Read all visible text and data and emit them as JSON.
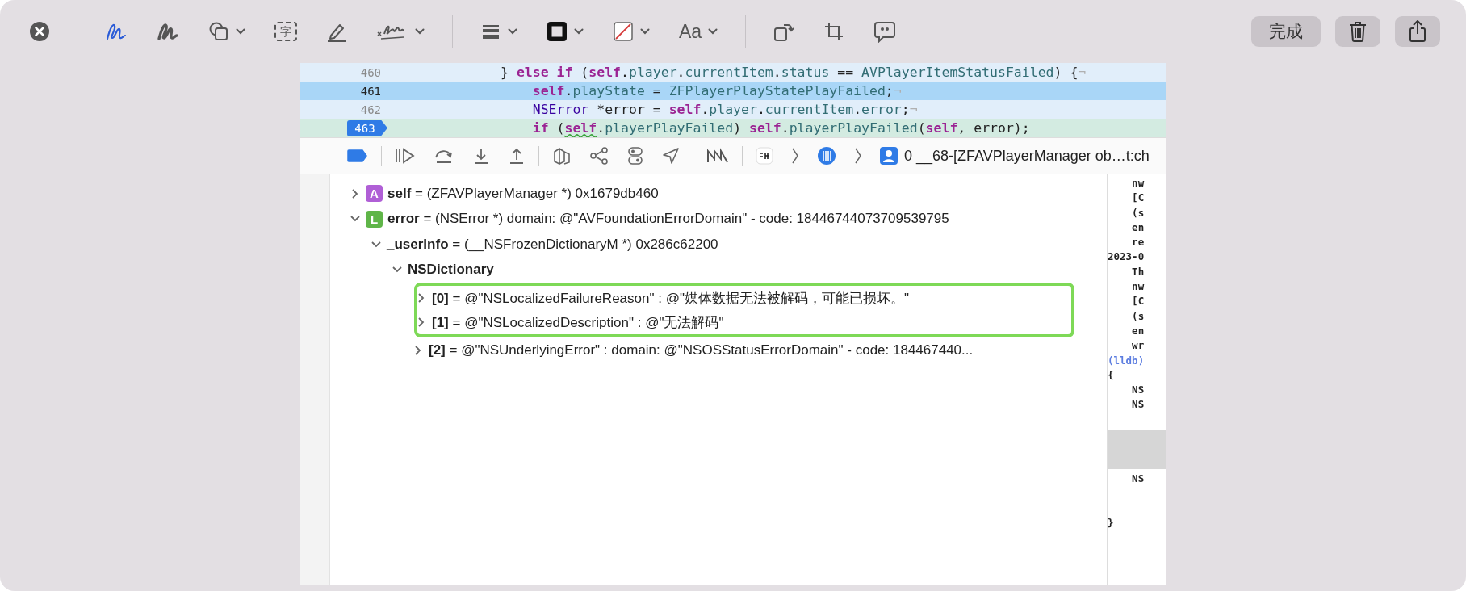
{
  "toolbar": {
    "tools": [
      {
        "kind": "sketch",
        "selected": true,
        "menu": false
      },
      {
        "kind": "draw",
        "selected": false,
        "menu": false
      },
      {
        "kind": "shapes",
        "selected": false,
        "menu": true
      },
      {
        "kind": "textbox",
        "selected": false,
        "menu": false,
        "label": "字"
      },
      {
        "kind": "highlight",
        "selected": false,
        "menu": false
      },
      {
        "kind": "sign",
        "selected": false,
        "menu": true
      },
      {
        "kind": "divider"
      },
      {
        "kind": "line-style",
        "selected": false,
        "menu": true
      },
      {
        "kind": "border-color",
        "selected": false,
        "menu": true
      },
      {
        "kind": "fill-color",
        "selected": false,
        "menu": true
      },
      {
        "kind": "font",
        "selected": false,
        "menu": true,
        "label": "Aa"
      },
      {
        "kind": "divider"
      },
      {
        "kind": "rotate",
        "selected": false,
        "menu": false
      },
      {
        "kind": "crop",
        "selected": false,
        "menu": false
      },
      {
        "kind": "description",
        "selected": false,
        "menu": false
      }
    ],
    "buttons": [
      {
        "kind": "text",
        "label": "完成"
      },
      {
        "kind": "trash"
      },
      {
        "kind": "share"
      }
    ]
  },
  "code": {
    "lines": [
      {
        "number": "460",
        "selected": false,
        "current": false,
        "breakpoint": false,
        "tokens": [
          {
            "kind": "plain",
            "text": "} "
          },
          {
            "kind": "keyword",
            "text": "else if"
          },
          {
            "kind": "plain",
            "text": " ("
          },
          {
            "kind": "keyword",
            "text": "self"
          },
          {
            "kind": "plain",
            "text": "."
          },
          {
            "kind": "property",
            "text": "player"
          },
          {
            "kind": "plain",
            "text": "."
          },
          {
            "kind": "property",
            "text": "currentItem"
          },
          {
            "kind": "plain",
            "text": "."
          },
          {
            "kind": "property",
            "text": "status"
          },
          {
            "kind": "plain",
            "text": " == "
          },
          {
            "kind": "enum",
            "text": "AVPlayerItemStatusFailed"
          },
          {
            "kind": "plain",
            "text": ") {"
          },
          {
            "kind": "invisible",
            "text": "¬"
          }
        ],
        "children": [
          {
            "number": "461",
            "selected": true,
            "current": false,
            "breakpoint": false,
            "tokens": [
              {
                "kind": "keyword",
                "text": "self"
              },
              {
                "kind": "plain",
                "text": "."
              },
              {
                "kind": "property",
                "text": "playState"
              },
              {
                "kind": "plain",
                "text": " = "
              },
              {
                "kind": "enum",
                "text": "ZFPlayerPlayStatePlayFailed"
              },
              {
                "kind": "plain",
                "text": ";"
              },
              {
                "kind": "invisible",
                "text": "¬"
              }
            ]
          },
          {
            "number": "462",
            "selected": false,
            "current": false,
            "breakpoint": false,
            "tokens": [
              {
                "kind": "type",
                "text": "NSError"
              },
              {
                "kind": "plain",
                "text": " *error = "
              },
              {
                "kind": "keyword",
                "text": "self"
              },
              {
                "kind": "plain",
                "text": "."
              },
              {
                "kind": "property",
                "text": "player"
              },
              {
                "kind": "plain",
                "text": "."
              },
              {
                "kind": "property",
                "text": "currentItem"
              },
              {
                "kind": "plain",
                "text": "."
              },
              {
                "kind": "property",
                "text": "error"
              },
              {
                "kind": "plain",
                "text": ";"
              },
              {
                "kind": "invisible",
                "text": "¬"
              }
            ]
          },
          {
            "number": "463",
            "selected": false,
            "current": true,
            "breakpoint": true,
            "tokens": [
              {
                "kind": "keyword",
                "text": "if"
              },
              {
                "kind": "plain",
                "text": " ("
              },
              {
                "kind": "keyword-flagged",
                "text": "self"
              },
              {
                "kind": "plain",
                "text": "."
              },
              {
                "kind": "property",
                "text": "playerPlayFailed"
              },
              {
                "kind": "plain",
                "text": ") "
              },
              {
                "kind": "keyword",
                "text": "self"
              },
              {
                "kind": "plain",
                "text": "."
              },
              {
                "kind": "property",
                "text": "playerPlayFailed"
              },
              {
                "kind": "plain",
                "text": "("
              },
              {
                "kind": "keyword",
                "text": "self"
              },
              {
                "kind": "plain",
                "text": ", error);"
              }
            ]
          }
        ]
      }
    ]
  },
  "debug_bar": {
    "breakpoints_active": true,
    "frame": "0 __68-[ZFAVPlayerManager ob…t:ch"
  },
  "variables": [
    {
      "kind": "variable",
      "badge": "A",
      "color": "#b05fd6",
      "text": "**self** = (ZFAVPlayerManager *) 0x1679db460",
      "expanded": false,
      "boxed": false
    },
    {
      "kind": "variable",
      "badge": "L",
      "color": "#5fb548",
      "text": "**error** = (NSError *) domain: @\"AVFoundationErrorDomain\" - code: 18446744073709539795",
      "expanded": true,
      "boxed": false,
      "children": [
        {
          "kind": "variable",
          "text": "**_userInfo** = (__NSFrozenDictionaryM *) 0x286c62200",
          "expanded": true,
          "boxed": false,
          "children": [
            {
              "kind": "group",
              "text": "NSDictionary",
              "expanded": true,
              "boxed": false,
              "children": [
                {
                  "kind": "variable",
                  "text": "**[0]** = @\"NSLocalizedFailureReason\" : @\"媒体数据无法被解码，可能已损坏。\"",
                  "expanded": false,
                  "boxed": true
                },
                {
                  "kind": "variable",
                  "text": "**[1]** = @\"NSLocalizedDescription\" : @\"无法解码\"",
                  "expanded": false,
                  "boxed": true
                },
                {
                  "kind": "variable",
                  "text": "**[2]** = @\"NSUnderlyingError\" : domain: @\"NSOSStatusErrorDomain\" - code: 184467440...",
                  "expanded": false,
                  "boxed": false
                }
              ]
            }
          ]
        }
      ]
    }
  ],
  "console": [
    {
      "kind": "text",
      "text": "    nw"
    },
    {
      "kind": "text",
      "text": "    [C"
    },
    {
      "kind": "text",
      "text": "    (s"
    },
    {
      "kind": "text",
      "text": "    en"
    },
    {
      "kind": "text",
      "text": "    re"
    },
    {
      "kind": "text",
      "text": "2023-0"
    },
    {
      "kind": "text",
      "text": "    Th"
    },
    {
      "kind": "text",
      "text": "    nw"
    },
    {
      "kind": "text",
      "text": "    [C"
    },
    {
      "kind": "text",
      "text": "    (s"
    },
    {
      "kind": "text",
      "text": "    en"
    },
    {
      "kind": "text",
      "text": "    wr"
    },
    {
      "kind": "prompt",
      "text": "(lldb)"
    },
    {
      "kind": "text",
      "text": "{"
    },
    {
      "kind": "text",
      "text": "    NS"
    },
    {
      "kind": "text",
      "text": "    NS"
    },
    {
      "kind": "blank"
    },
    {
      "kind": "highlight"
    },
    {
      "kind": "text",
      "text": "    NS"
    },
    {
      "kind": "blank"
    },
    {
      "kind": "blank"
    },
    {
      "kind": "text",
      "text": "}"
    }
  ]
}
